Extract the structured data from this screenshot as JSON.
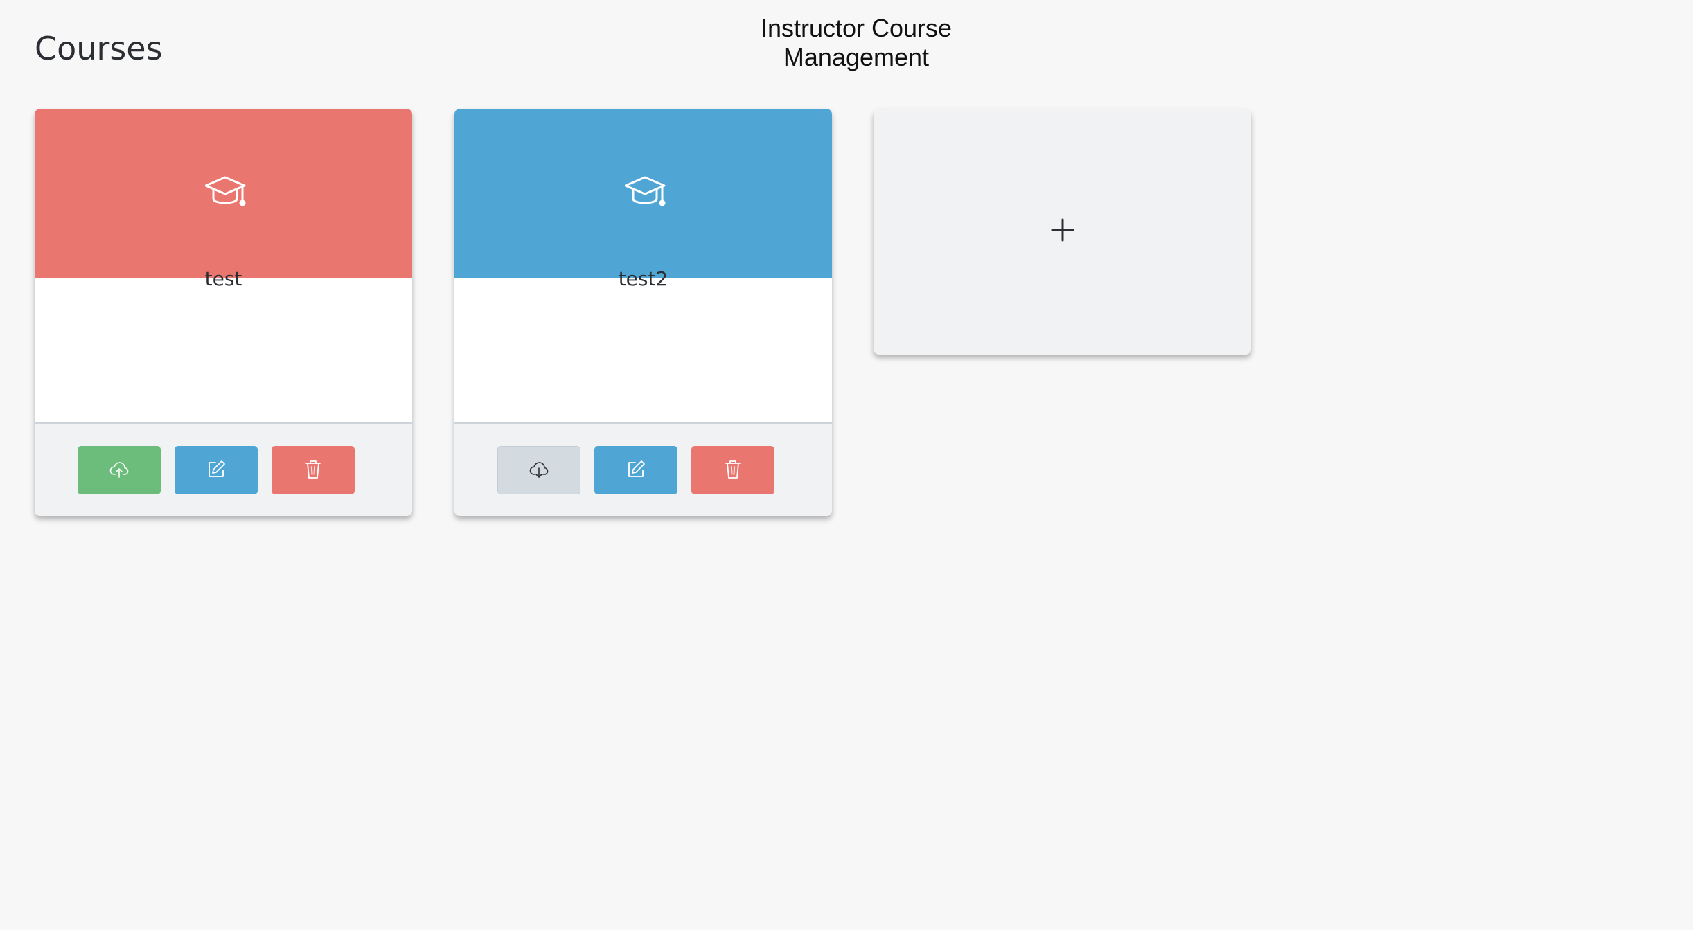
{
  "page": {
    "heading": "Courses",
    "header_title": "Instructor Course Management"
  },
  "colors": {
    "red": "#ea7670",
    "blue": "#4fa6d5",
    "green": "#6cbc7b",
    "light_gray": "#d3dae0",
    "icon_dark": "#2b2e33",
    "white": "#ffffff"
  },
  "courses": [
    {
      "name": "test",
      "banner_color": "#ea7670",
      "banner_icon": "graduation-cap-icon",
      "actions": [
        {
          "name": "publish",
          "icon": "cloud-upload-icon",
          "color": "#6cbc7b",
          "icon_color": "#ffffff"
        },
        {
          "name": "edit",
          "icon": "edit-icon",
          "color": "#4fa6d5",
          "icon_color": "#ffffff"
        },
        {
          "name": "delete",
          "icon": "trash-icon",
          "color": "#ea7670",
          "icon_color": "#ffffff"
        }
      ]
    },
    {
      "name": "test2",
      "banner_color": "#4fa6d5",
      "banner_icon": "graduation-cap-icon",
      "actions": [
        {
          "name": "download",
          "icon": "cloud-download-icon",
          "color": "#d3dae0",
          "icon_color": "#2b2e33"
        },
        {
          "name": "edit",
          "icon": "edit-icon",
          "color": "#4fa6d5",
          "icon_color": "#ffffff"
        },
        {
          "name": "delete",
          "icon": "trash-icon",
          "color": "#ea7670",
          "icon_color": "#ffffff"
        }
      ]
    }
  ],
  "add_card": {
    "icon": "plus-icon"
  }
}
